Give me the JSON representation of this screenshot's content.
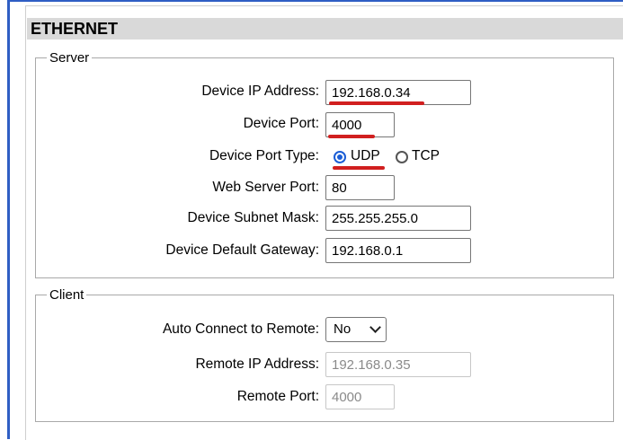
{
  "section_title": "ETHERNET",
  "server": {
    "legend": "Server",
    "device_ip_label": "Device IP Address:",
    "device_ip_value": "192.168.0.34",
    "device_port_label": "Device Port:",
    "device_port_value": "4000",
    "port_type_label": "Device Port Type:",
    "port_type_options": [
      "UDP",
      "TCP"
    ],
    "port_type_selected": "UDP",
    "web_port_label": "Web Server Port:",
    "web_port_value": "80",
    "subnet_label": "Device Subnet Mask:",
    "subnet_value": "255.255.255.0",
    "gateway_label": "Device Default Gateway:",
    "gateway_value": "192.168.0.1"
  },
  "client": {
    "legend": "Client",
    "auto_connect_label": "Auto Connect to Remote:",
    "auto_connect_value": "No",
    "remote_ip_label": "Remote IP Address:",
    "remote_ip_value": "192.168.0.35",
    "remote_port_label": "Remote Port:",
    "remote_port_value": "4000"
  },
  "colors": {
    "annotation_underline": "#d11f1f",
    "radio_accent": "#1a5dd6",
    "header_bg": "#d9d9d9",
    "frame_accent": "#2f5ec4"
  }
}
